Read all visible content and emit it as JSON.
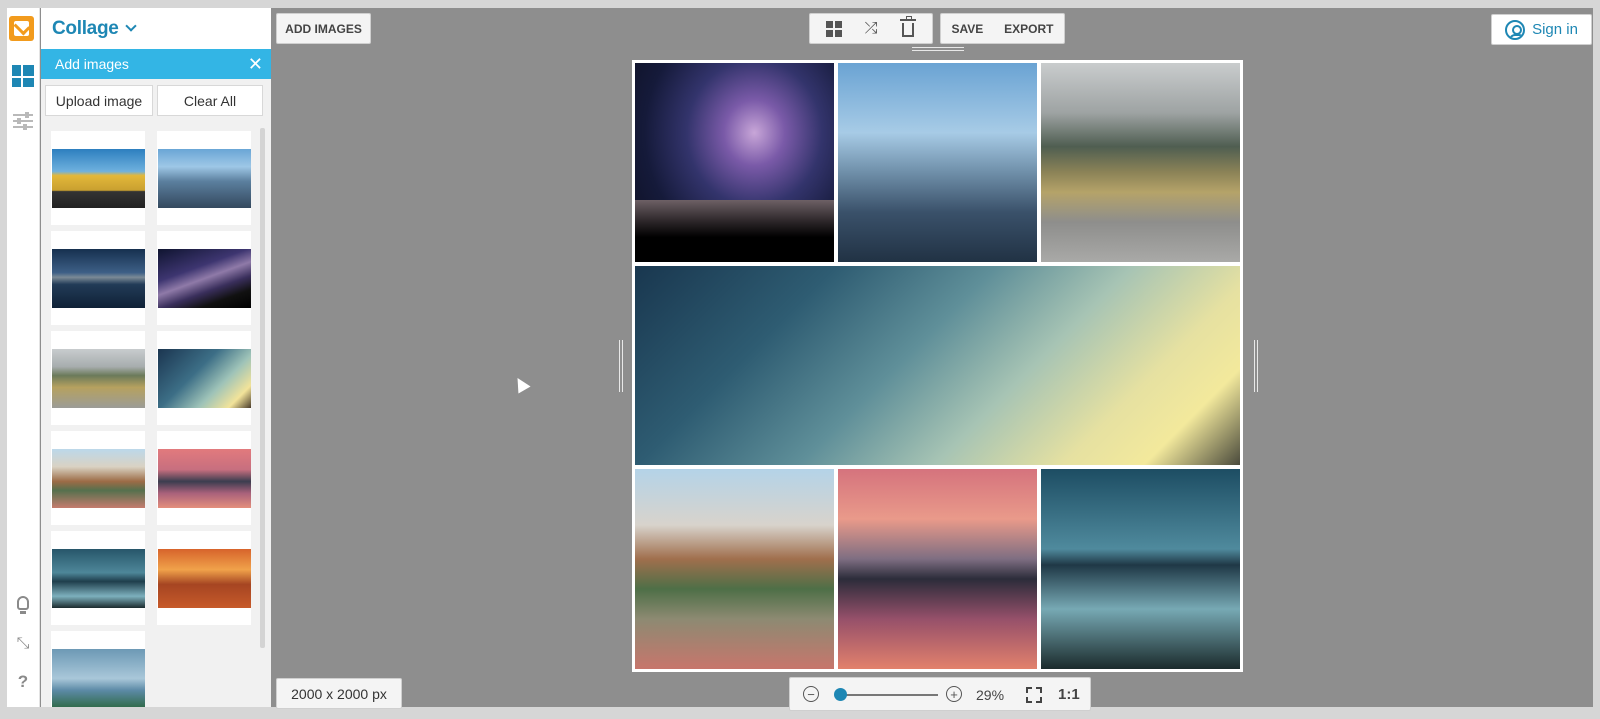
{
  "app": {
    "title": "Collage"
  },
  "panel": {
    "header": "Add images",
    "upload_label": "Upload image",
    "clear_label": "Clear All"
  },
  "toolbar": {
    "add_images": "ADD IMAGES",
    "save": "SAVE",
    "export": "EXPORT",
    "icons": [
      "layout-grid-icon",
      "shuffle-icon",
      "trash-icon"
    ]
  },
  "account": {
    "sign_in": "Sign in"
  },
  "canvas": {
    "size_label": "2000 x 2000 px"
  },
  "zoom": {
    "percent": "29%",
    "ratio_label": "1:1",
    "level": 0.29
  },
  "thumbnails": [
    "road-wheat-field",
    "city-skyline",
    "mountain-lake-night",
    "milky-way-mountains",
    "foggy-road",
    "sunset-sky",
    "maroon-bells-lake",
    "pink-sunset-lake",
    "calm-blue-lake",
    "autumn-trees",
    "green-lighthouse"
  ],
  "colors": {
    "accent": "#1e87b4",
    "panel_bar": "#33b5e5",
    "logo": "#f29b1d",
    "workspace": "#8e8e8e"
  }
}
